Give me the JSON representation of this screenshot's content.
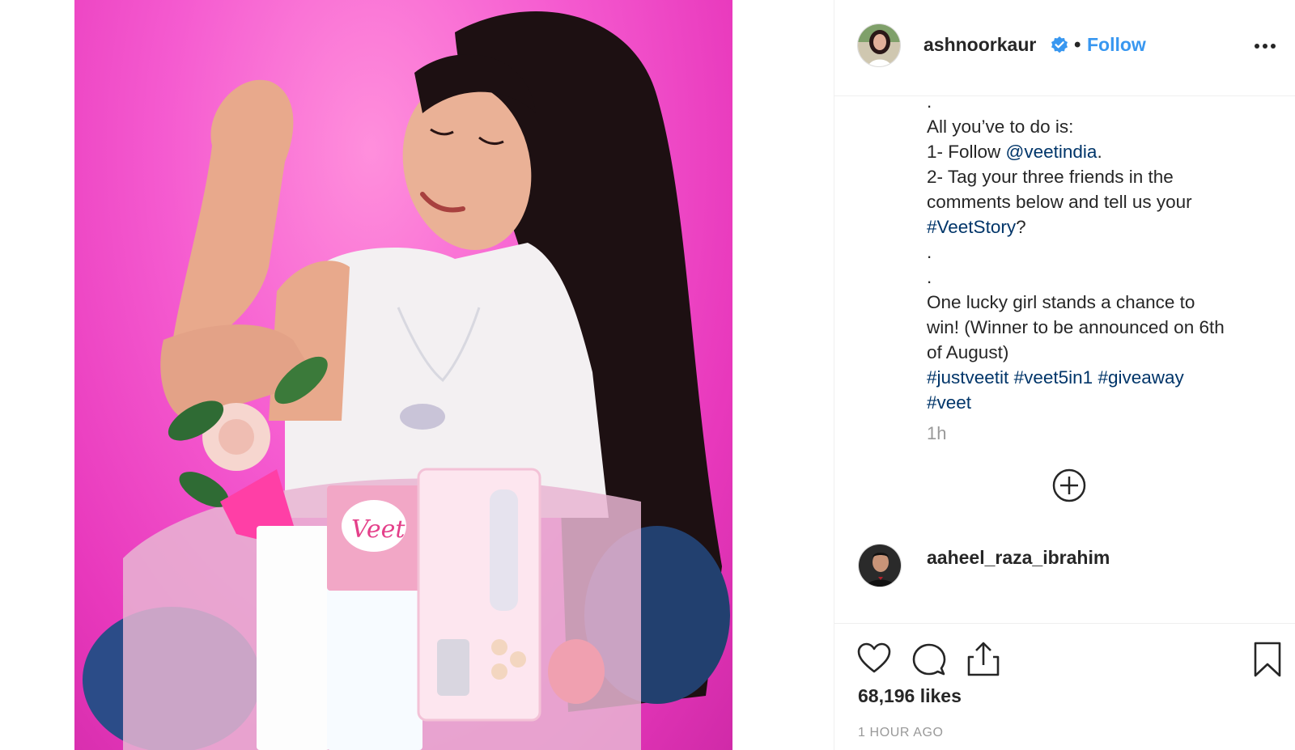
{
  "post": {
    "username": "ashnoorkaur",
    "separator": "•",
    "follow_label": "Follow",
    "verified_icon": "verified-badge-icon",
    "more_icon": "more-options-icon"
  },
  "caption": {
    "lines": [
      ".",
      "All you’ve to do is:",
      "1- Follow ",
      "@veetindia",
      ".",
      "2- Tag your three friends in the",
      "comments below and tell us your",
      "#VeetStory",
      "?",
      ".",
      ".",
      "One lucky girl stands a chance to",
      "win! (Winner to be announced on 6th",
      "of August)",
      "#justveetit",
      "#veet5in1",
      "#giveaway",
      "#veet"
    ],
    "time": "1h"
  },
  "comment": {
    "username": "aaheel_raza_ibrahim"
  },
  "actions": {
    "like_icon": "heart-icon",
    "comment_icon": "comment-icon",
    "share_icon": "share-icon",
    "save_icon": "bookmark-icon",
    "load_more_icon": "plus-circle-icon"
  },
  "stats": {
    "likes": "68,196 likes",
    "time_ago": "1 HOUR AGO"
  },
  "colors": {
    "link": "#3897f0",
    "hashtag": "#003569",
    "muted": "#999999",
    "photo_bg": "#f55bd0"
  }
}
